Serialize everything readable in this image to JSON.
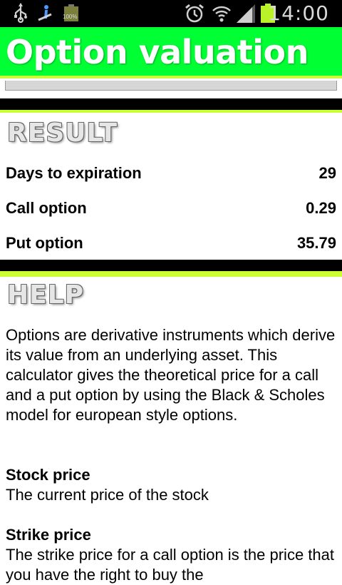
{
  "status_bar": {
    "time": "14:00",
    "battery_small_label": "100%",
    "icons": [
      "usb-icon",
      "debug-icon",
      "battery-icon",
      "alarm-icon",
      "wifi-icon",
      "signal-icon",
      "battery-full-icon"
    ]
  },
  "app": {
    "title": "Option valuation",
    "accent_color": "#00ff33",
    "highlight_color": "#ccff33"
  },
  "result": {
    "heading": "RESULT",
    "rows": [
      {
        "label": "Days to expiration",
        "value": "29"
      },
      {
        "label": "Call option",
        "value": "0.29"
      },
      {
        "label": "Put option",
        "value": "35.79"
      }
    ]
  },
  "help": {
    "heading": "HELP",
    "intro": "Options are derivative instruments which derive its value from an underlying asset. This calculator gives the theoretical price for a call and a put option by using the Black & Scholes model for european style options.",
    "items": [
      {
        "title": "Stock price",
        "text": "The current price of the stock"
      },
      {
        "title": "Strike price",
        "text": "The strike price for a call option is the price that you have the right to buy the"
      }
    ]
  }
}
